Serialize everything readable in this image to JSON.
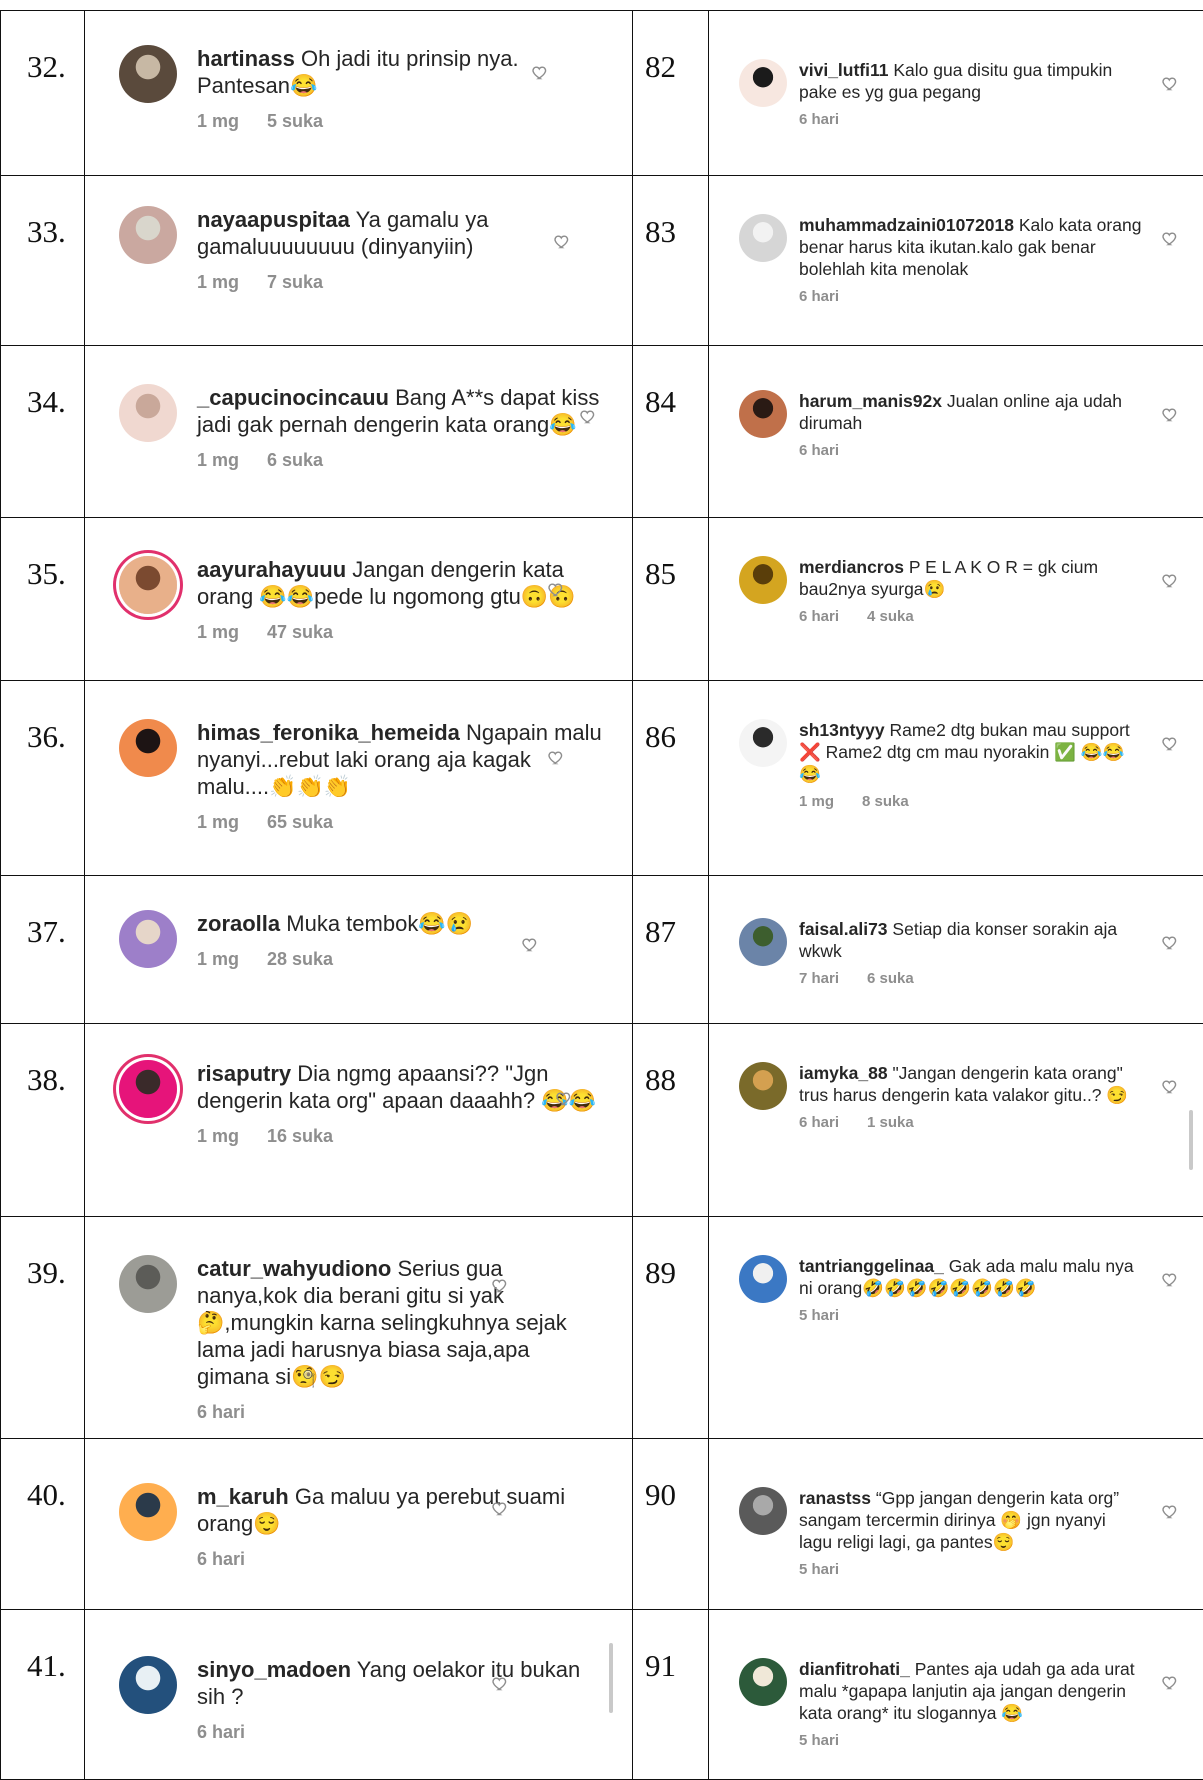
{
  "rows": [
    {
      "left": {
        "num": "32.",
        "user": "hartinass",
        "text": "Oh jadi itu prinsip nya. Pantesan😂",
        "time": "1 mg",
        "likes": "5 suka"
      },
      "right": {
        "num": "82",
        "user": "vivi_lutfi11",
        "text": "Kalo gua disitu gua timpukin pake es yg gua pegang",
        "time": "6 hari",
        "likes": ""
      }
    },
    {
      "left": {
        "num": "33.",
        "user": "nayaapuspitaa",
        "text": "Ya gamalu ya gamaluuuuuuuu (dinyanyiin)",
        "time": "1 mg",
        "likes": "7 suka"
      },
      "right": {
        "num": "83",
        "user": "muhammadzaini01072018",
        "text": "Kalo kata orang benar harus kita ikutan.kalo gak benar bolehlah kita menolak",
        "time": "6 hari",
        "likes": ""
      }
    },
    {
      "left": {
        "num": "34.",
        "user": "_capucinocincauu",
        "text": "Bang A**s dapat kiss jadi gak pernah dengerin kata orang😂",
        "time": "1 mg",
        "likes": "6 suka"
      },
      "right": {
        "num": "84",
        "user": "harum_manis92x",
        "text": "Jualan online aja udah dirumah",
        "time": "6 hari",
        "likes": ""
      }
    },
    {
      "left": {
        "num": "35.",
        "user": "aayurahayuuu",
        "text": "Jangan dengerin kata orang 😂😂pede lu ngomong gtu🙃🙃",
        "time": "1 mg",
        "likes": "47 suka"
      },
      "right": {
        "num": "85",
        "user": "merdiancros",
        "text": "P E L A K O R = gk cium bau2nya syurga😢",
        "time": "6 hari",
        "likes": "4 suka"
      }
    },
    {
      "left": {
        "num": "36.",
        "user": "himas_feronika_hemeida",
        "text": "Ngapain malu nyanyi...rebut laki orang aja kagak malu....👏👏👏",
        "time": "1 mg",
        "likes": "65 suka"
      },
      "right": {
        "num": "86",
        "user": "sh13ntyyy",
        "text": "Rame2 dtg bukan mau support ❌ Rame2 dtg cm mau nyorakin ✅ 😂😂😂",
        "time": "1 mg",
        "likes": "8 suka"
      }
    },
    {
      "left": {
        "num": "37.",
        "user": "zoraolla",
        "text": "Muka tembok😂😢",
        "time": "1 mg",
        "likes": "28 suka"
      },
      "right": {
        "num": "87",
        "user": "faisal.ali73",
        "text": "Setiap dia konser sorakin aja wkwk",
        "time": "7 hari",
        "likes": "6 suka"
      }
    },
    {
      "left": {
        "num": "38.",
        "user": "risaputry",
        "text": "Dia ngmg apaansi?? \"Jgn dengerin kata org\" apaan daaahh? 😂😂",
        "time": "1 mg",
        "likes": "16 suka"
      },
      "right": {
        "num": "88",
        "user": "iamyka_88",
        "text": "\"Jangan dengerin kata orang\" trus harus dengerin kata valakor gitu..? 😏",
        "time": "6 hari",
        "likes": "1 suka"
      }
    },
    {
      "left": {
        "num": "39.",
        "user": "catur_wahyudiono",
        "text": "Serius gua nanya,kok dia berani gitu si yak 🤔,mungkin karna selingkuhnya sejak lama jadi harusnya biasa saja,apa gimana si🧐😏",
        "time": "6 hari",
        "likes": ""
      },
      "right": {
        "num": "89",
        "user": "tantrianggelinaa_",
        "text": "Gak ada malu malu nya ni orang🤣🤣🤣🤣🤣🤣🤣🤣",
        "time": "5 hari",
        "likes": ""
      }
    },
    {
      "left": {
        "num": "40.",
        "user": "m_karuh",
        "text": "Ga maluu ya perebut suami orang😌",
        "time": "6 hari",
        "likes": ""
      },
      "right": {
        "num": "90",
        "user": "ranastss",
        "text": "“Gpp jangan dengerin kata org” sangam tercermin dirinya 🤭 jgn nyanyi lagu religi lagi, ga pantes😌",
        "time": "5 hari",
        "likes": ""
      }
    },
    {
      "left": {
        "num": "41.",
        "user": "sinyo_madoen",
        "text": "Yang oelakor itu bukan sih ?",
        "time": "6 hari",
        "likes": ""
      },
      "right": {
        "num": "91",
        "user": "dianfitrohati_",
        "text": "Pantes aja udah ga ada urat malu *gapapa lanjutin aja jangan dengerin kata orang* itu slogannya 😂",
        "time": "5 hari",
        "likes": ""
      }
    }
  ],
  "colors": {
    "border": "#111111",
    "text": "#262626",
    "meta": "#8e8e8e",
    "story_ring": "#e1306c"
  },
  "icons": {
    "like": "heart-outline-icon"
  }
}
